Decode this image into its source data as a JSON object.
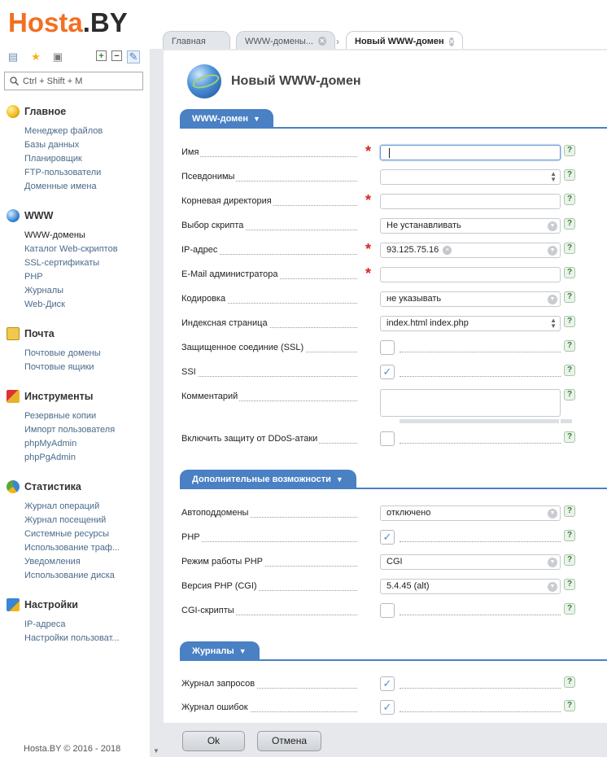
{
  "logo": {
    "part1": "Hosta",
    "part2": ".BY"
  },
  "sidebar": {
    "search_placeholder": "Ctrl + Shift + M",
    "groups": [
      {
        "title": "Главное",
        "items": [
          "Менеджер файлов",
          "Базы данных",
          "Планировщик",
          "FTP-пользователи",
          "Доменные имена"
        ]
      },
      {
        "title": "WWW",
        "items": [
          "WWW-домены",
          "Каталог Web-скриптов",
          "SSL-сертификаты",
          "PHP",
          "Журналы",
          "Web-Диск"
        ]
      },
      {
        "title": "Почта",
        "items": [
          "Почтовые домены",
          "Почтовые ящики"
        ]
      },
      {
        "title": "Инструменты",
        "items": [
          "Резервные копии",
          "Импорт пользователя",
          "phpMyAdmin",
          "phpPgAdmin"
        ]
      },
      {
        "title": "Статистика",
        "items": [
          "Журнал операций",
          "Журнал посещений",
          "Системные ресурсы",
          "Использование траф...",
          "Уведомления",
          "Использование диска"
        ]
      },
      {
        "title": "Настройки",
        "items": [
          "IP-адреса",
          "Настройки пользоват..."
        ]
      }
    ],
    "footer": "Hosta.BY © 2016 - 2018"
  },
  "tabs": [
    {
      "label": "Главная"
    },
    {
      "label": "WWW-домены..."
    },
    {
      "label": "Новый WWW-домен"
    }
  ],
  "page": {
    "title": "Новый WWW-домен"
  },
  "sections": {
    "www": "WWW-домен",
    "extra": "Дополнительные возможности",
    "logs": "Журналы"
  },
  "form": {
    "name": {
      "label": "Имя",
      "value": ""
    },
    "aliases": {
      "label": "Псевдонимы",
      "value": ""
    },
    "root": {
      "label": "Корневая директория",
      "value": ""
    },
    "script": {
      "label": "Выбор скрипта",
      "value": "Не устанавливать"
    },
    "ip": {
      "label": "IP-адрес",
      "value": "93.125.75.16"
    },
    "email": {
      "label": "E-Mail администратора",
      "value": ""
    },
    "charset": {
      "label": "Кодировка",
      "value": "не указывать"
    },
    "index": {
      "label": "Индексная страница",
      "value": "index.html index.php"
    },
    "ssl": {
      "label": "Защищенное соединие (SSL)",
      "checked": false
    },
    "ssi": {
      "label": "SSI",
      "checked": true
    },
    "comment": {
      "label": "Комментарий",
      "value": ""
    },
    "ddos": {
      "label": "Включить защиту от DDoS-атаки",
      "checked": false
    },
    "autosub": {
      "label": "Автоподдомены",
      "value": "отключено"
    },
    "php": {
      "label": "PHP",
      "checked": true
    },
    "phpmode": {
      "label": "Режим работы PHP",
      "value": "CGI"
    },
    "phpver": {
      "label": "Версия PHP (CGI)",
      "value": "5.4.45 (alt)"
    },
    "cgi": {
      "label": "CGI-скрипты",
      "checked": false
    },
    "accesslog": {
      "label": "Журнал запросов",
      "checked": true
    },
    "errorlog": {
      "label": "Журнал ошибок",
      "checked": true
    }
  },
  "buttons": {
    "ok": "Ok",
    "cancel": "Отмена"
  },
  "help_glyph": "?",
  "colors": {
    "brand_orange": "#f36f21",
    "section_blue": "#4a80c4",
    "required_red": "#dd2222"
  }
}
